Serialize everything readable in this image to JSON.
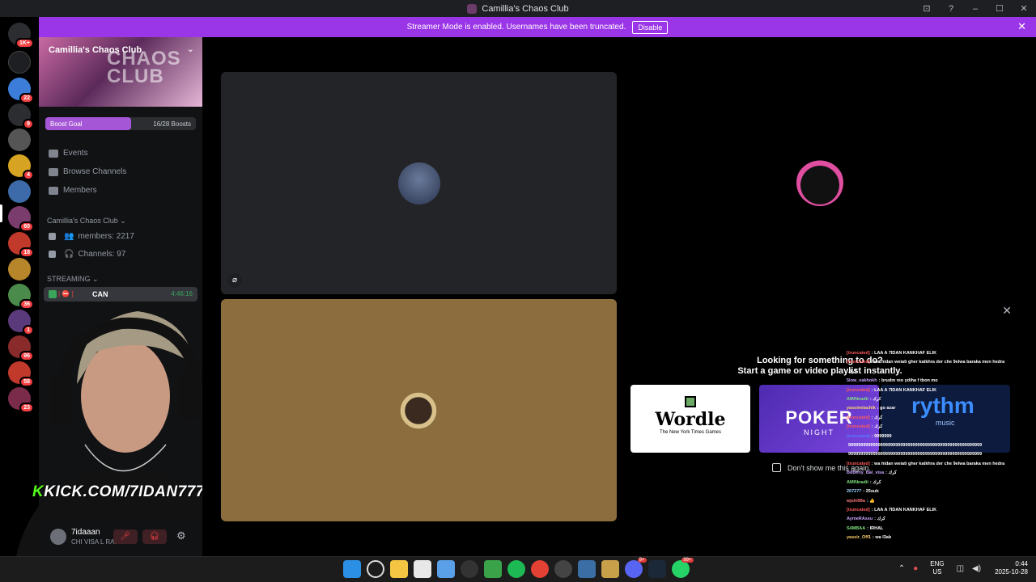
{
  "window": {
    "title": "Camillia's Chaos Club",
    "controls": [
      "⊡",
      "?",
      "–",
      "☐",
      "✕"
    ]
  },
  "banner": {
    "text": "Streamer Mode is enabled. Usernames have been truncated.",
    "button": "Disable",
    "close": "✕"
  },
  "servers": {
    "badges": [
      "1K+",
      "22",
      "9",
      "4",
      "60",
      "18",
      "36",
      "1",
      "96",
      "58",
      "23"
    ]
  },
  "server": {
    "name": "Camillia's Chaos Club",
    "banner_text": "CHAOS CLUB",
    "boost_label": "Boost Goal",
    "boost_count": "16/28 Boosts",
    "boost_progress": 0.57,
    "nav": [
      "Events",
      "Browse Channels",
      "Members"
    ],
    "category": "Camillia's Chaos Club",
    "stats": [
      "members: 2217",
      "Channels: 97"
    ],
    "streaming_category": "STREAMING",
    "stream_channel": "CAN",
    "stream_prefix": "| ⛔ ]",
    "stream_time": "4:46:16",
    "stream_user": "7i"
  },
  "webcam": {
    "overlay": "KICK.COM/7IDAN7777",
    "overlay_k": "K",
    "overlay_rest": "KICK.COM/7IDAN7777"
  },
  "user": {
    "name": "7idaaan",
    "status": "CHI VISA L RABAT"
  },
  "activity": {
    "title_line1": "Looking for something to do?",
    "title_line2": "Start a game or video playlist instantly.",
    "close": "✕",
    "wordle": {
      "title": "Wordle",
      "sub": "The New York Times Games"
    },
    "poker": {
      "title": "POKER",
      "sub": "NIGHT"
    },
    "rythm": {
      "title": "rythm",
      "sub": "music"
    },
    "dont_show": "Don't show me this again."
  },
  "chat": [
    {
      "user": "[truncated]",
      "msg": ": LAA A 7IDAN KANKHAF ELIK",
      "color": "#ff5a5a"
    },
    {
      "user": "[truncated]",
      "msg": ": wa hidan weiati gher katkhra der che 9elwa baraka men hedra",
      "color": "#ff5a5a"
    },
    {
      "user": "",
      "msg": "كرك",
      "color": "#ffffff"
    },
    {
      "user": "5low_eakhokh",
      "msg": ": brudm reo ydiha f tbon mo",
      "color": "#c9a6ff"
    },
    {
      "user": "[truncated]",
      "msg": ": LAA A 7IDAN KANKHAF ELIK",
      "color": "#ff5a5a"
    },
    {
      "user": "AMINnadii",
      "msg": ": كرك",
      "color": "#7ee07e"
    },
    {
      "user": "yassineiachik",
      "msg": ": go azar",
      "color": "#ffd36b"
    },
    {
      "user": "[truncated]",
      "msg": ": كرك",
      "color": "#ff5a5a"
    },
    {
      "user": "[truncated]",
      "msg": ": كرك",
      "color": "#ff5a5a"
    },
    {
      "user": "[truncated]",
      "msg": ": 9999999",
      "color": "#5a7aff"
    },
    {
      "user": "",
      "msg": "999999999999999999999999999999999999999999999999999999",
      "color": "#ffffff"
    },
    {
      "user": "",
      "msg": "999999999999999999999999999999999999999999999999999999",
      "color": "#ffffff"
    },
    {
      "user": "[truncated]",
      "msg": ": wa hidan weiati gher katkhra der che 9elwa baraka men hedra",
      "color": "#ff5a5a"
    },
    {
      "user": "BdBeny_Bal_visa",
      "msg": ": كرك",
      "color": "#c9a6ff"
    },
    {
      "user": "AMINnadii",
      "msg": ": كرك",
      "color": "#7ee07e"
    },
    {
      "user": "267277",
      "msg": ": 25sub",
      "color": "#9fd3ff"
    },
    {
      "user": "wjshi99a",
      "msg": ": 👍",
      "color": "#ff7a7a"
    },
    {
      "user": "[truncated]",
      "msg": ": LAA A 7IDAN KANKHAF ELIK",
      "color": "#ff5a5a"
    },
    {
      "user": "AymeRAssu",
      "msg": ": كرك",
      "color": "#c9a6ff"
    },
    {
      "user": "S4MBAA",
      "msg": ": IRHAL",
      "color": "#7ee07e"
    },
    {
      "user": "yassir_Off1",
      "msg": ": wa l3ab",
      "color": "#ffd36b"
    }
  ],
  "taskbar": {
    "badges": {
      "discord": "9+",
      "whatsapp": "99+"
    },
    "lang_top": "ENG",
    "lang_bottom": "US",
    "time": "0:44",
    "date": "2025-10-28"
  },
  "colors": {
    "accent": "#9b35e8",
    "online": "#3ba55c",
    "danger": "#f23f42",
    "tile_gray": "#232428",
    "tile_gold": "#8c6d3d"
  }
}
